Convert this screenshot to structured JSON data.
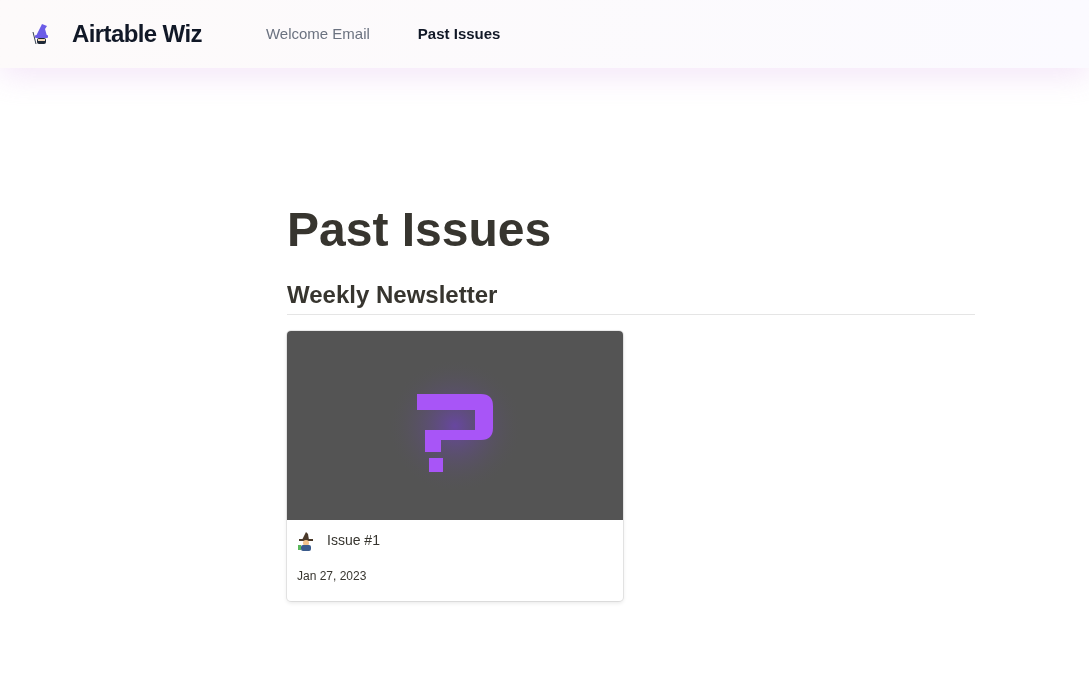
{
  "brand": {
    "name": "Airtable Wiz"
  },
  "nav": [
    {
      "label": "Welcome Email",
      "selected": false
    },
    {
      "label": "Past Issues",
      "selected": true
    }
  ],
  "page": {
    "title": "Past Issues"
  },
  "sections": [
    {
      "heading": "Weekly Newsletter",
      "cards": [
        {
          "title": "Issue #1",
          "date": "Jan 27, 2023"
        }
      ]
    }
  ]
}
